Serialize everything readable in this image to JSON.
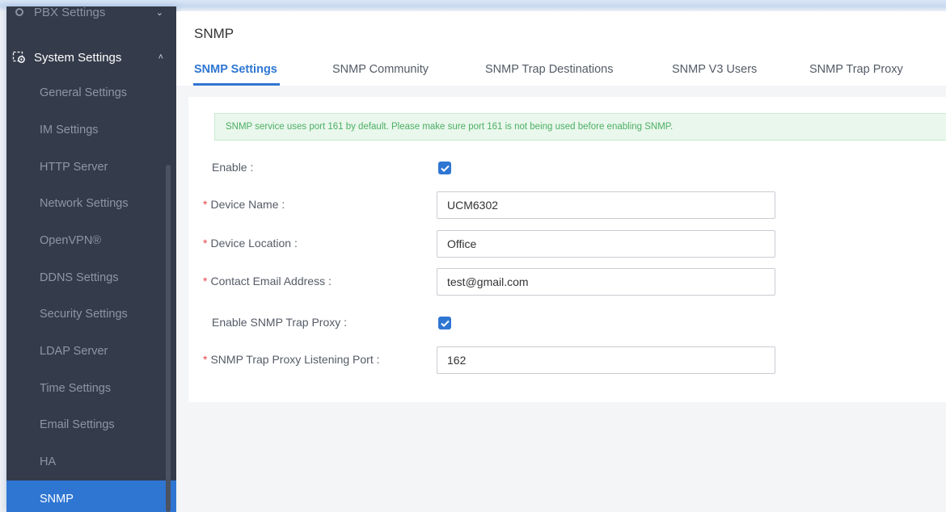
{
  "sidebar": {
    "pbx_group": {
      "label": "PBX Settings"
    },
    "system_group": {
      "label": "System Settings"
    },
    "items": [
      {
        "label": "General Settings"
      },
      {
        "label": "IM Settings"
      },
      {
        "label": "HTTP Server"
      },
      {
        "label": "Network Settings"
      },
      {
        "label": "OpenVPN®"
      },
      {
        "label": "DDNS Settings"
      },
      {
        "label": "Security Settings"
      },
      {
        "label": "LDAP Server"
      },
      {
        "label": "Time Settings"
      },
      {
        "label": "Email Settings"
      },
      {
        "label": "HA"
      },
      {
        "label": "SNMP"
      }
    ]
  },
  "page": {
    "title": "SNMP"
  },
  "tabs": [
    {
      "label": "SNMP Settings"
    },
    {
      "label": "SNMP Community"
    },
    {
      "label": "SNMP Trap Destinations"
    },
    {
      "label": "SNMP V3 Users"
    },
    {
      "label": "SNMP Trap Proxy"
    }
  ],
  "notice": "SNMP service uses port 161 by default. Please make sure port 161 is not being used before enabling SNMP.",
  "form": {
    "enable": {
      "label": "Enable",
      "checked": true
    },
    "device_name": {
      "label": "Device Name",
      "value": "UCM6302"
    },
    "device_location": {
      "label": "Device Location",
      "value": "Office"
    },
    "contact_email": {
      "label": "Contact Email Address",
      "value": "test@gmail.com"
    },
    "enable_trap_proxy": {
      "label": "Enable SNMP Trap Proxy",
      "checked": true
    },
    "trap_proxy_port": {
      "label": "SNMP Trap Proxy Listening Port",
      "value": "162"
    }
  },
  "colors": {
    "accent": "#2f76d2",
    "sidebar_bg": "#343b4a",
    "notice_bg": "#e9f7ec",
    "notice_text": "#4caf63",
    "required": "#e5484d"
  }
}
